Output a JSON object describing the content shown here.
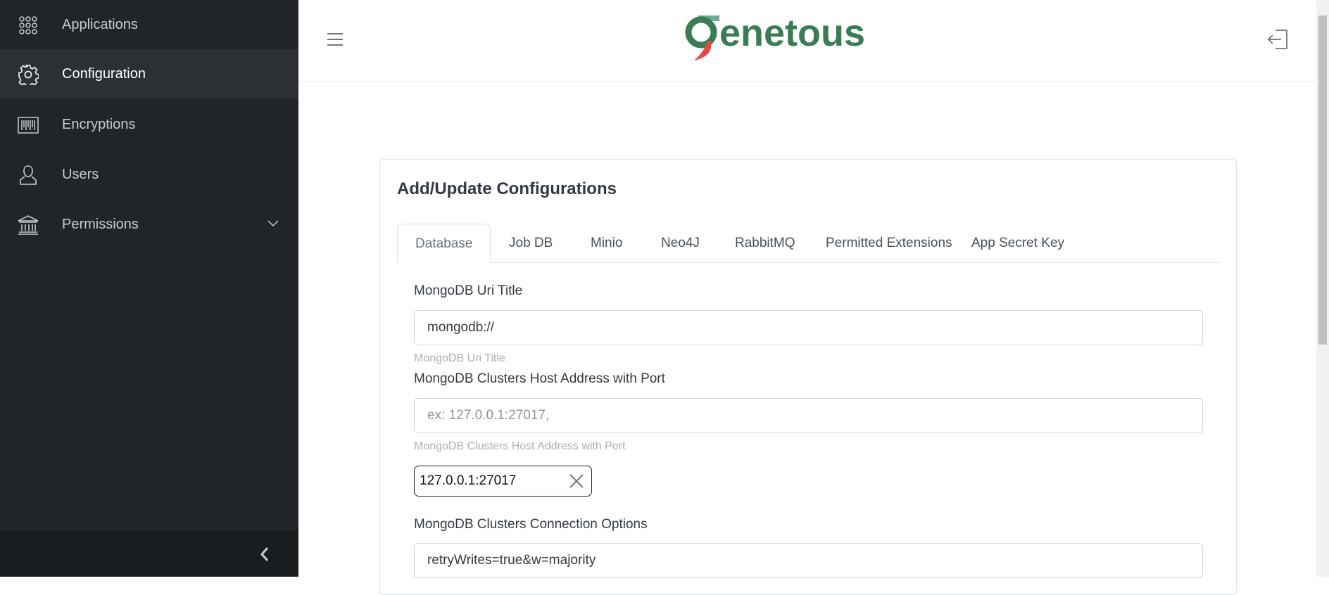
{
  "sidebar": {
    "items": [
      {
        "label": "Applications",
        "icon": "grid-icon"
      },
      {
        "label": "Configuration",
        "icon": "gear-icon",
        "active": true
      },
      {
        "label": "Encryptions",
        "icon": "barcode-icon"
      },
      {
        "label": "Users",
        "icon": "user-icon"
      },
      {
        "label": "Permissions",
        "icon": "bank-icon",
        "expandable": true
      }
    ]
  },
  "header": {
    "logo": "genetous",
    "colors": {
      "brand": "#3a7d55",
      "accent": "#e8484a"
    }
  },
  "card": {
    "title": "Add/Update Configurations",
    "tabs": [
      "Database",
      "Job DB",
      "Minio",
      "Neo4J",
      "RabbitMQ",
      "Permitted Extensions",
      "App Secret Key"
    ],
    "active_tab": "Database",
    "fields": [
      {
        "label": "MongoDB Uri Title",
        "value": "mongodb://",
        "help": "MongoDB Uri Title"
      },
      {
        "label": "MongoDB Clusters Host Address with Port",
        "placeholder": "ex: 127.0.0.1:27017,",
        "help": "MongoDB Clusters Host Address with Port",
        "chips": [
          "127.0.0.1:27017"
        ]
      },
      {
        "label": "MongoDB Clusters Connection Options",
        "value": "retryWrites=true&w=majority"
      }
    ]
  }
}
